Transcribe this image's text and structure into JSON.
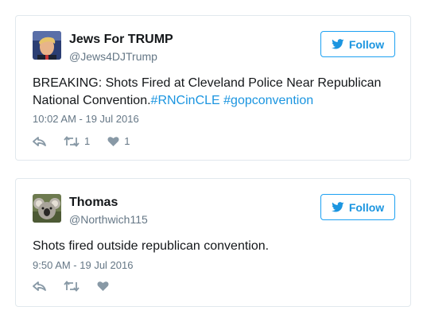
{
  "tweets": [
    {
      "name": "Jews For TRUMP",
      "handle": "@Jews4DJTrump",
      "follow_label": "Follow",
      "text_before": "BREAKING: Shots Fired at Cleveland Police Near Republican National Convention.",
      "hashtag1": "#RNCinCLE",
      "hashtag2": "#gopconvention",
      "timestamp": "10:02 AM - 19 Jul 2016",
      "retweets": "1",
      "likes": "1",
      "avatar_icon": "trump-portrait-icon"
    },
    {
      "name": "Thomas",
      "handle": "@Northwich115",
      "follow_label": "Follow",
      "text": "Shots fired outside republican convention.",
      "timestamp": "9:50 AM - 19 Jul 2016",
      "avatar_icon": "koala-icon"
    }
  ],
  "colors": {
    "accent": "#1b95e0",
    "border": "#e1e8ed",
    "muted": "#657786",
    "icon_gray": "#8899a6"
  }
}
